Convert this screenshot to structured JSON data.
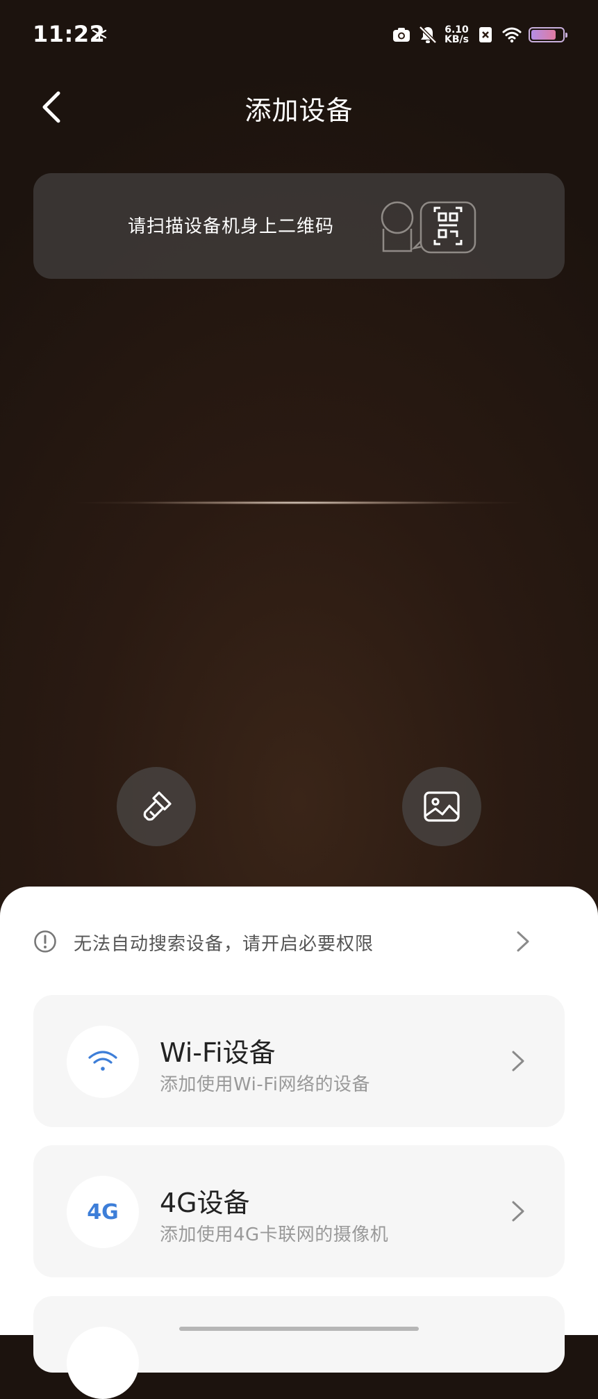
{
  "status_bar": {
    "time": "11:22",
    "net_speed_value": "6.10",
    "net_speed_unit": "KB/s",
    "battery_level": 0.8,
    "icons": [
      "pinwheel-icon",
      "camera-icon",
      "bell-muted-icon",
      "x-badge-icon",
      "wifi-icon",
      "battery-icon"
    ]
  },
  "header": {
    "title": "添加设备",
    "back_icon": "chevron-left-icon"
  },
  "scan": {
    "tip_text": "请扫描设备机身上二维码",
    "illustration": "camera-qr-icon"
  },
  "tools": {
    "flashlight_icon": "flashlight-icon",
    "gallery_icon": "image-icon"
  },
  "sheet": {
    "permission_notice": "无法自动搜索设备，请开启必要权限",
    "devices": [
      {
        "title": "Wi-Fi设备",
        "subtitle": "添加使用Wi-Fi网络的设备",
        "icon": "wifi-icon"
      },
      {
        "title": "4G设备",
        "subtitle": "添加使用4G卡联网的摄像机",
        "icon_text": "4G"
      }
    ]
  },
  "colors": {
    "accent_blue": "#3d7ed8",
    "sheet_bg": "#ffffff",
    "card_bg": "#f6f6f6"
  }
}
